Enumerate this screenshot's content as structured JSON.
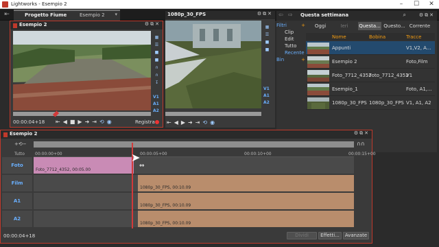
{
  "window": {
    "title": "Lightworks - Esempio 2"
  },
  "project": {
    "tab_label": "Progetto Fiume",
    "sequence_label": "Esempio 2"
  },
  "source_viewer": {
    "title": "Esempio 2",
    "timecode": "00:00:04+18",
    "tracks": [
      "V1",
      "A1",
      "A2"
    ],
    "record_label": "Registra"
  },
  "clip_viewer": {
    "title": "1080p_30_FPS",
    "tracks": [
      "V1",
      "A1",
      "A2"
    ]
  },
  "bin": {
    "title": "Questa settimana",
    "tabs": [
      {
        "label": "Oggi",
        "state": "normal"
      },
      {
        "label": "Ieri",
        "state": "dim"
      },
      {
        "label": "Questa...",
        "state": "active"
      },
      {
        "label": "Questo...",
        "state": "normal"
      },
      {
        "label": "Corrente",
        "state": "normal"
      }
    ],
    "filters": [
      {
        "label": "Filtri",
        "accent": true
      },
      {
        "label": "Clip",
        "accent": false
      },
      {
        "label": "Edit",
        "accent": false
      },
      {
        "label": "Tutto",
        "accent": false
      },
      {
        "label": "Recente",
        "accent": "blue"
      },
      {
        "label": "Bin",
        "accent": true
      }
    ],
    "columns": {
      "name": "Nome",
      "reel": "Bobina",
      "tracks": "Tracce"
    },
    "rows": [
      {
        "name": "Appunti",
        "reel": "",
        "tracks": "V1,V2, A...",
        "selected": true
      },
      {
        "name": "Esempio 2",
        "reel": "",
        "tracks": "Foto,Film",
        "selected": false
      },
      {
        "name": "Foto_7712_4352",
        "reel": "Foto_7712_4352",
        "tracks": "V1",
        "selected": false
      },
      {
        "name": "Esempio_1",
        "reel": "",
        "tracks": "Foto, A1,...",
        "selected": false
      },
      {
        "name": "1080p_30_FPS",
        "reel": "1080p_30_FPS",
        "tracks": "V1, A1, A2",
        "selected": false
      }
    ]
  },
  "timeline": {
    "title": "Esempio 2",
    "ruler_all": "Tutto",
    "ruler": [
      "00:00:00+00",
      "00:00:05+00",
      "00:00:10+00",
      "00:00:15+00"
    ],
    "tracks": [
      {
        "name": "Foto",
        "clip": "Foto_7712_4352, 00:05.00"
      },
      {
        "name": "Film",
        "clip": "1080p_30_FPS, 00:10.09"
      },
      {
        "name": "A1",
        "clip": "1080p_30_FPS, 00:10.09"
      },
      {
        "name": "A2",
        "clip": "1080p_30_FPS, 00:10.09"
      }
    ],
    "timecode": "00:00:04+18",
    "buttons": {
      "split": "Dividi",
      "effects": "Effetti...",
      "advanced": "Avanzate"
    }
  },
  "colors": {
    "accent_red": "#c0392b",
    "track_blue": "#6ab0ff",
    "photo_clip": "#c98bb5",
    "audio_clip": "#b98d6c",
    "selected_row": "#234a6e",
    "filter_accent": "#f39c12"
  }
}
